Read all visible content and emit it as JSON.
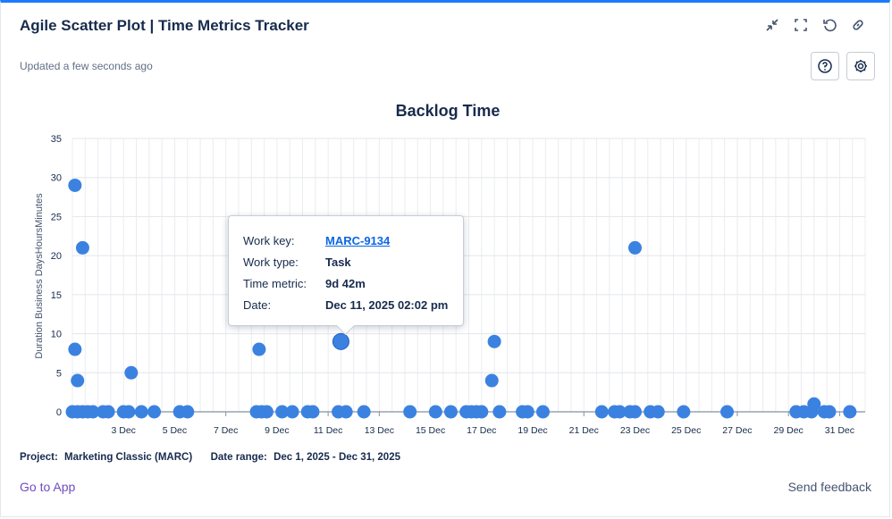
{
  "header": {
    "title": "Agile Scatter Plot | Time Metrics Tracker",
    "updated": "Updated a few seconds ago",
    "icons": [
      "minimize-icon",
      "fullscreen-icon",
      "refresh-icon",
      "link-icon",
      "help-icon",
      "settings-icon"
    ]
  },
  "colors": {
    "accent": "#1d7afc",
    "point": "#3b82e0",
    "link": "#6e4dbe"
  },
  "tooltip": {
    "rows": [
      {
        "key": "Work key:",
        "value": "MARC-9134",
        "link": true
      },
      {
        "key": "Work type:",
        "value": "Task"
      },
      {
        "key": "Time metric:",
        "value": "9d 42m"
      },
      {
        "key": "Date:",
        "value": "Dec 11, 2025 02:02 pm"
      }
    ]
  },
  "footer": {
    "project_label": "Project:",
    "project_value": "Marketing Classic (MARC)",
    "range_label": "Date range:",
    "range_value": "Dec 1, 2025 - Dec 31, 2025",
    "goto": "Go to App",
    "feedback": "Send feedback"
  },
  "chart_data": {
    "type": "scatter",
    "title": "Backlog Time",
    "xlabel": "",
    "ylabel": "Duration Business DaysHoursMinutes",
    "ylim": [
      0,
      35
    ],
    "yticks": [
      0,
      5,
      10,
      15,
      20,
      25,
      30,
      35
    ],
    "xlim": [
      1.0,
      32.0
    ],
    "xticks": [
      {
        "day": 3,
        "label": "3 Dec"
      },
      {
        "day": 5,
        "label": "5 Dec"
      },
      {
        "day": 7,
        "label": "7 Dec"
      },
      {
        "day": 9,
        "label": "9 Dec"
      },
      {
        "day": 11,
        "label": "11 Dec"
      },
      {
        "day": 13,
        "label": "13 Dec"
      },
      {
        "day": 15,
        "label": "15 Dec"
      },
      {
        "day": 17,
        "label": "17 Dec"
      },
      {
        "day": 19,
        "label": "19 Dec"
      },
      {
        "day": 21,
        "label": "21 Dec"
      },
      {
        "day": 23,
        "label": "23 Dec"
      },
      {
        "day": 25,
        "label": "25 Dec"
      },
      {
        "day": 27,
        "label": "27 Dec"
      },
      {
        "day": 29,
        "label": "29 Dec"
      },
      {
        "day": 31,
        "label": "31 Dec"
      }
    ],
    "grid": true,
    "legend": "none",
    "highlight_index": 0,
    "points": [
      {
        "x": 11.5,
        "y": 9
      },
      {
        "x": 1.1,
        "y": 29
      },
      {
        "x": 1.4,
        "y": 21
      },
      {
        "x": 1.1,
        "y": 8
      },
      {
        "x": 1.2,
        "y": 4
      },
      {
        "x": 3.3,
        "y": 5
      },
      {
        "x": 8.3,
        "y": 8
      },
      {
        "x": 23.0,
        "y": 21
      },
      {
        "x": 17.5,
        "y": 9
      },
      {
        "x": 17.4,
        "y": 4
      },
      {
        "x": 30.0,
        "y": 1
      },
      {
        "x": 1.0,
        "y": 0
      },
      {
        "x": 1.2,
        "y": 0
      },
      {
        "x": 1.4,
        "y": 0
      },
      {
        "x": 1.6,
        "y": 0
      },
      {
        "x": 1.8,
        "y": 0
      },
      {
        "x": 2.2,
        "y": 0
      },
      {
        "x": 2.4,
        "y": 0
      },
      {
        "x": 3.0,
        "y": 0
      },
      {
        "x": 3.2,
        "y": 0
      },
      {
        "x": 3.7,
        "y": 0
      },
      {
        "x": 4.2,
        "y": 0
      },
      {
        "x": 5.2,
        "y": 0
      },
      {
        "x": 5.5,
        "y": 0
      },
      {
        "x": 8.2,
        "y": 0
      },
      {
        "x": 8.4,
        "y": 0
      },
      {
        "x": 8.6,
        "y": 0
      },
      {
        "x": 9.2,
        "y": 0
      },
      {
        "x": 9.6,
        "y": 0
      },
      {
        "x": 10.2,
        "y": 0
      },
      {
        "x": 10.4,
        "y": 0
      },
      {
        "x": 11.4,
        "y": 0
      },
      {
        "x": 11.7,
        "y": 0
      },
      {
        "x": 12.4,
        "y": 0
      },
      {
        "x": 14.2,
        "y": 0
      },
      {
        "x": 15.2,
        "y": 0
      },
      {
        "x": 15.8,
        "y": 0
      },
      {
        "x": 16.4,
        "y": 0
      },
      {
        "x": 16.6,
        "y": 0
      },
      {
        "x": 16.8,
        "y": 0
      },
      {
        "x": 17.0,
        "y": 0
      },
      {
        "x": 17.7,
        "y": 0
      },
      {
        "x": 18.6,
        "y": 0
      },
      {
        "x": 18.8,
        "y": 0
      },
      {
        "x": 19.4,
        "y": 0
      },
      {
        "x": 21.7,
        "y": 0
      },
      {
        "x": 22.2,
        "y": 0
      },
      {
        "x": 22.4,
        "y": 0
      },
      {
        "x": 22.8,
        "y": 0
      },
      {
        "x": 23.0,
        "y": 0
      },
      {
        "x": 23.6,
        "y": 0
      },
      {
        "x": 23.9,
        "y": 0
      },
      {
        "x": 24.9,
        "y": 0
      },
      {
        "x": 26.6,
        "y": 0
      },
      {
        "x": 29.3,
        "y": 0
      },
      {
        "x": 29.6,
        "y": 0
      },
      {
        "x": 29.9,
        "y": 0
      },
      {
        "x": 30.4,
        "y": 0
      },
      {
        "x": 30.6,
        "y": 0
      },
      {
        "x": 31.4,
        "y": 0
      }
    ]
  }
}
